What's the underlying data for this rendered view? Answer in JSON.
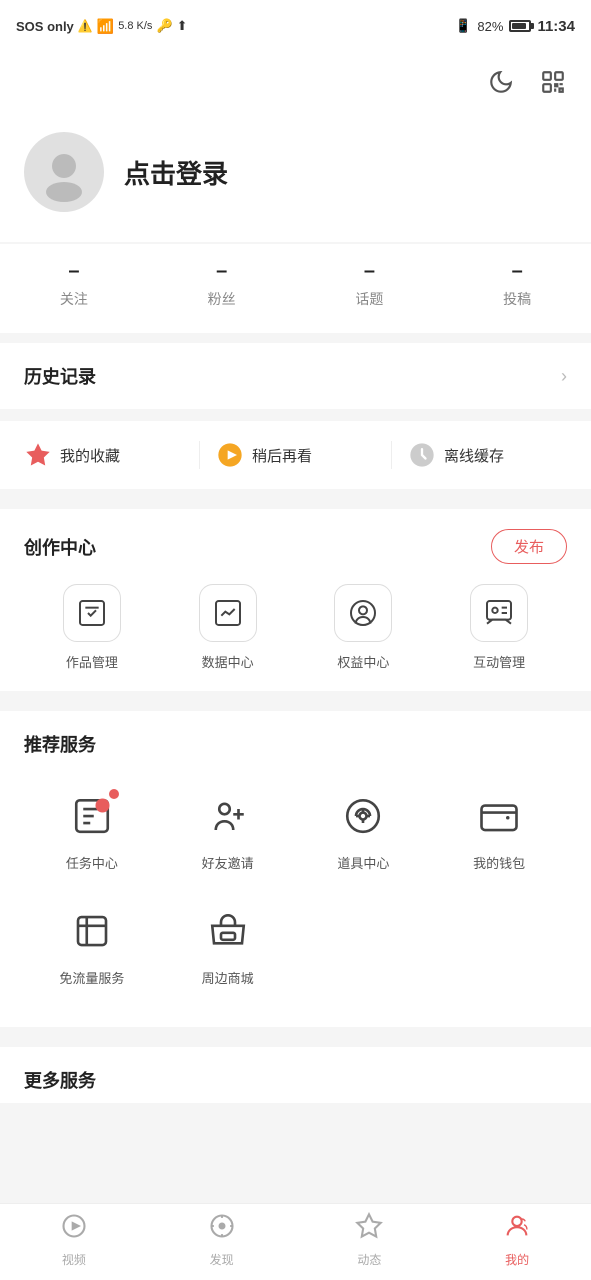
{
  "statusBar": {
    "left": "SOS only",
    "wifi": "wifi-icon",
    "speed": "5.8 K/s",
    "battery_pct": "82%",
    "time": "11:34"
  },
  "toolbar": {
    "night_icon": "🌙",
    "scan_icon": "⬜"
  },
  "profile": {
    "avatar_alt": "avatar",
    "login_text": "点击登录"
  },
  "stats": [
    {
      "value": "–",
      "label": "关注"
    },
    {
      "value": "–",
      "label": "粉丝"
    },
    {
      "value": "–",
      "label": "话题"
    },
    {
      "value": "–",
      "label": "投稿"
    }
  ],
  "history": {
    "title": "历史记录",
    "chevron": "›"
  },
  "bookmarks": [
    {
      "label": "我的收藏",
      "color": "#e85d5d"
    },
    {
      "label": "稍后再看",
      "color": "#f5a623"
    },
    {
      "label": "离线缓存",
      "color": "#aaa"
    }
  ],
  "creation": {
    "title": "创作中心",
    "publish_btn": "发布",
    "items": [
      {
        "label": "作品管理"
      },
      {
        "label": "数据中心"
      },
      {
        "label": "权益中心"
      },
      {
        "label": "互动管理"
      }
    ]
  },
  "services": {
    "title": "推荐服务",
    "items": [
      {
        "label": "任务中心",
        "badge": true
      },
      {
        "label": "好友邀请",
        "badge": false
      },
      {
        "label": "道具中心",
        "badge": false
      },
      {
        "label": "我的钱包",
        "badge": false
      },
      {
        "label": "免流量服务",
        "badge": false
      },
      {
        "label": "周边商城",
        "badge": false
      }
    ]
  },
  "more": {
    "title": "更多服务"
  },
  "bottomNav": {
    "items": [
      {
        "label": "视频",
        "active": false
      },
      {
        "label": "发现",
        "active": false
      },
      {
        "label": "动态",
        "active": false
      },
      {
        "label": "我的",
        "active": true
      }
    ]
  }
}
